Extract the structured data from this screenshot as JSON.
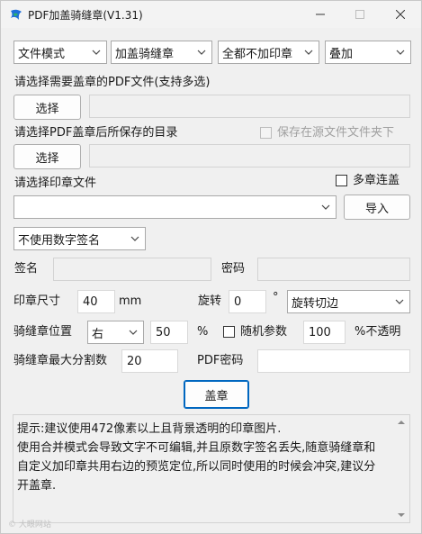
{
  "window": {
    "title": "PDF加盖骑缝章(V1.31)"
  },
  "row1": {
    "mode": "文件模式",
    "stamp_type": "加盖骑缝章",
    "page_range": "全都不加印章",
    "overlay": "叠加"
  },
  "pdf_select": {
    "label": "请选择需要盖章的PDF文件(支持多选)",
    "button": "选择",
    "path": ""
  },
  "save_dir": {
    "label": "请选择PDF盖章后所保存的目录",
    "save_in_source_label": "保存在源文件文件夹下",
    "button": "选择",
    "path": ""
  },
  "stamp_file": {
    "label": "请选择印章文件",
    "multi_label": "多章连盖",
    "value": "",
    "import_button": "导入"
  },
  "signature": {
    "mode": "不使用数字签名",
    "name_label": "签名",
    "name_value": "",
    "password_label": "密码",
    "password_value": ""
  },
  "size": {
    "label": "印章尺寸",
    "value": "40",
    "unit": "mm",
    "rotate_label": "旋转",
    "rotate_value": "0",
    "degree": "°",
    "rotate_mode": "旋转切边"
  },
  "position": {
    "label": "骑缝章位置",
    "side": "右",
    "percent": "50",
    "percent_sign": "%",
    "random_label": "随机参数",
    "opacity": "100",
    "opacity_label": "%不透明"
  },
  "split": {
    "label": "骑缝章最大分割数",
    "value": "20",
    "pdf_password_label": "PDF密码",
    "pdf_password_value": ""
  },
  "stamp_button": "盖章",
  "tip": {
    "line1": "提示:建议使用472像素以上且背景透明的印章图片.",
    "line2": "使用合并模式会导致文字不可编辑,并且原数字签名丢失,随意骑缝章和自定义加印章共用右边的预览定位,所以同时使用的时候会冲突,建议分开盖章."
  },
  "watermark": "© 大眼网站"
}
